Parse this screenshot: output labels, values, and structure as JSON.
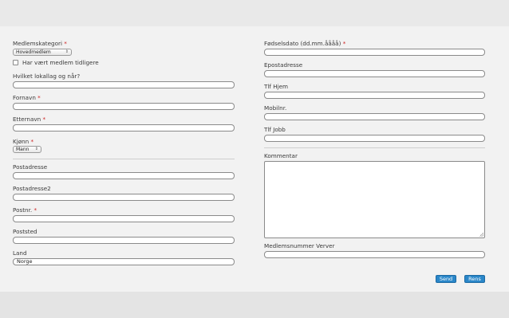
{
  "left": {
    "medlemskategori": {
      "label": "Medlemskategori",
      "required": "*",
      "value": "Hovedmedlem"
    },
    "tidligere": {
      "label": "Har vært medlem tidligere"
    },
    "lokallag": {
      "label": "Hvilket lokallag og når?",
      "value": ""
    },
    "fornavn": {
      "label": "Fornavn",
      "required": "*",
      "value": ""
    },
    "etternavn": {
      "label": "Etternavn",
      "required": "*",
      "value": ""
    },
    "kjonn": {
      "label": "Kjønn",
      "required": "*",
      "value": "Mann"
    },
    "postadresse": {
      "label": "Postadresse",
      "value": ""
    },
    "postadresse2": {
      "label": "Postadresse2",
      "value": ""
    },
    "postnr": {
      "label": "Postnr.",
      "required": "*",
      "value": ""
    },
    "poststed": {
      "label": "Poststed",
      "value": ""
    },
    "land": {
      "label": "Land",
      "value": "Norge"
    }
  },
  "right": {
    "fodselsdato": {
      "label": "Fødselsdato (dd.mm.åååå)",
      "required": "*",
      "value": ""
    },
    "epost": {
      "label": "Epostadresse",
      "value": ""
    },
    "tlf_hjem": {
      "label": "Tlf Hjem",
      "value": ""
    },
    "mobil": {
      "label": "Mobilnr.",
      "value": ""
    },
    "tlf_jobb": {
      "label": "Tlf Jobb",
      "value": ""
    },
    "kommentar": {
      "label": "Kommentar",
      "value": ""
    },
    "verver": {
      "label": "Medlemsnummer Verver",
      "value": ""
    }
  },
  "buttons": {
    "send": "Send",
    "rens": "Rens"
  },
  "colors": {
    "button": "#2a87c9",
    "required": "#cc2222",
    "panel": "#f2f2f2"
  }
}
